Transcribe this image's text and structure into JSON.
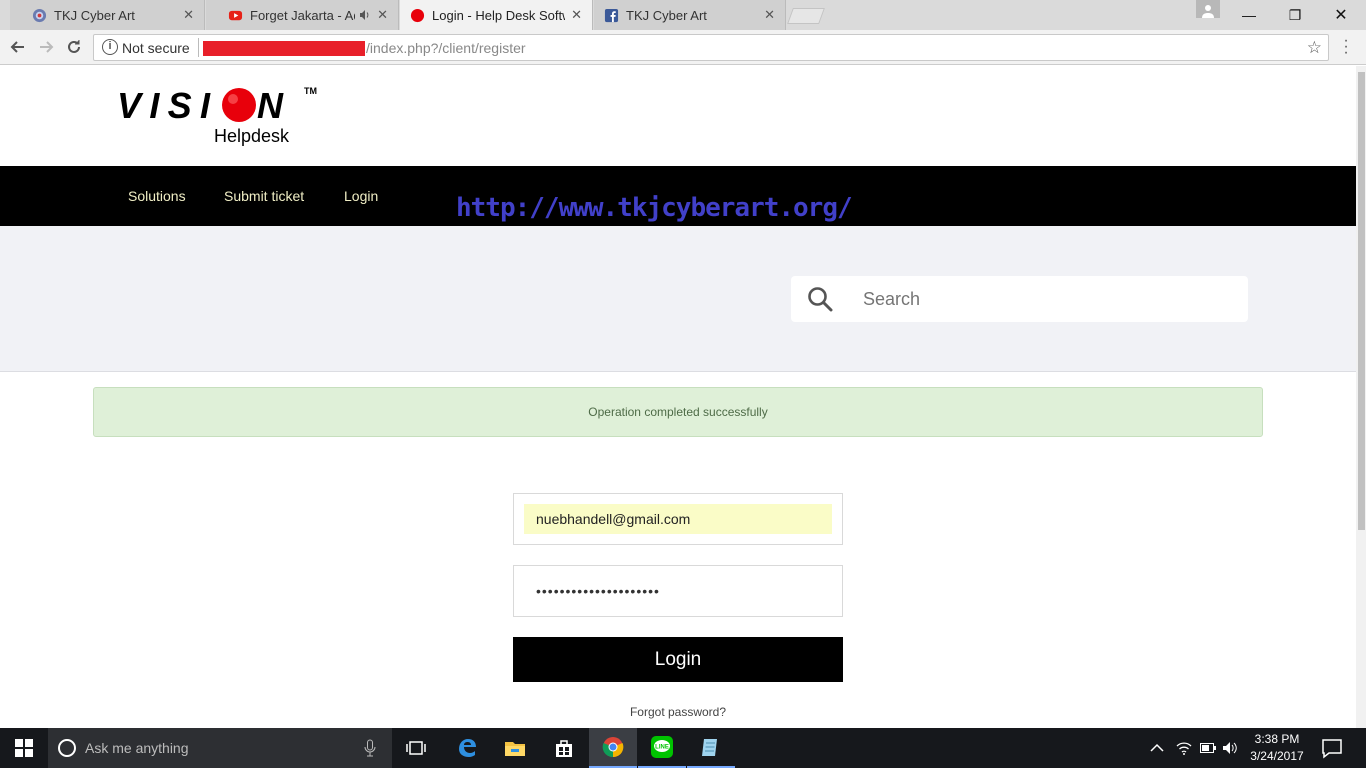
{
  "browser": {
    "tabs": [
      {
        "title": "TKJ Cyber Art",
        "favicon": "tkj-favicon-icon",
        "active": false
      },
      {
        "title": "Forget Jakarta - Adhit",
        "favicon": "youtube-icon",
        "audio": true,
        "active": false
      },
      {
        "title": "Login - Help Desk Softwa",
        "favicon": "red-circle-icon",
        "active": true
      },
      {
        "title": "TKJ Cyber Art",
        "favicon": "facebook-icon",
        "active": false
      }
    ],
    "close_glyph": "✕",
    "window_controls": {
      "minimize": "—",
      "maximize": "❐",
      "close": "✕"
    },
    "address": {
      "security_label": "Not secure",
      "url_path": "/index.php?/client/register"
    }
  },
  "site": {
    "logo": {
      "text": "VISION",
      "tm": "TM",
      "subtitle": "Helpdesk"
    },
    "nav": [
      {
        "label": "Solutions"
      },
      {
        "label": "Submit ticket"
      },
      {
        "label": "Login"
      }
    ],
    "watermark": "http://www.tkjcyberart.org/",
    "search": {
      "placeholder": "Search"
    },
    "alert": {
      "message": "Operation completed successfully"
    },
    "login_form": {
      "email_value": "nuebhandell@gmail.com",
      "password_mask": "•••••••••••••••••••••",
      "login_label": "Login",
      "forgot_label": "Forgot password?"
    }
  },
  "taskbar": {
    "search_placeholder": "Ask me anything",
    "apps": [
      "task-view-icon",
      "edge-icon",
      "file-explorer-icon",
      "store-icon",
      "chrome-icon",
      "line-icon",
      "notepad-icon"
    ],
    "clock": {
      "time": "3:38 PM",
      "date": "3/24/2017"
    }
  },
  "colors": {
    "nav_text": "#f0eec5",
    "watermark": "#4140c9",
    "alert_bg": "#dff0d8",
    "alert_text": "#4e6b47",
    "autofill_bg": "#fafcc7",
    "logo_red": "#e8000b"
  }
}
